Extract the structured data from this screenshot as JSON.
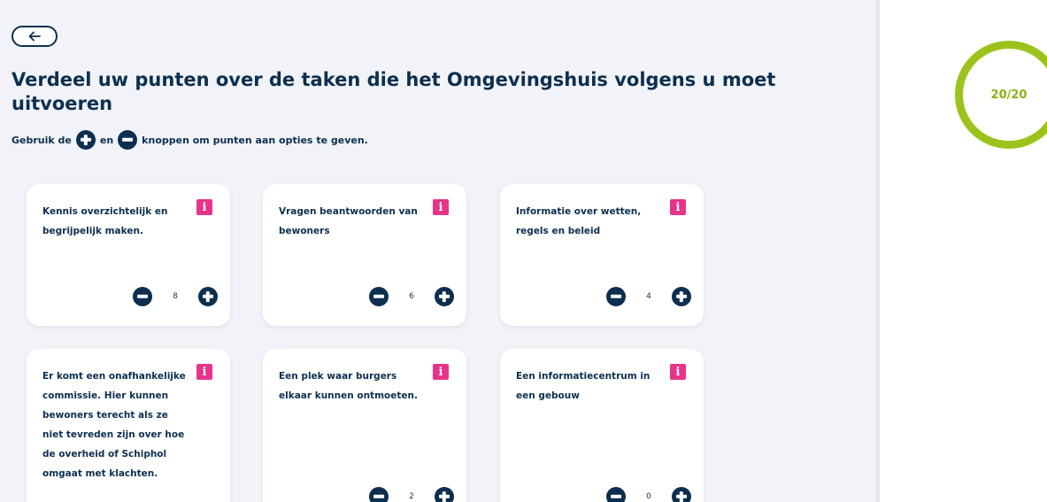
{
  "back_button": {
    "icon": "arrow-left-icon",
    "glyph": "←"
  },
  "title": "Verdeel uw punten over de taken die het Omgevingshuis volgens u moet uitvoeren",
  "instructions": {
    "prefix": "Gebruik de",
    "middle": "en",
    "suffix": "knoppen om punten aan opties te geven."
  },
  "options": [
    {
      "label": "Kennis overzichtelijk en begrijpelijk maken.",
      "value": "8",
      "info": "i"
    },
    {
      "label": "Vragen beantwoorden van bewoners",
      "value": "6",
      "info": "i"
    },
    {
      "label": "Informatie over wetten, regels en beleid",
      "value": "4",
      "info": "i"
    },
    {
      "label": "Er komt een onafhankelijke commissie. Hier kunnen bewoners terecht als ze niet tevreden zijn over hoe de overheid of Schiphol omgaat met klachten.",
      "value": "",
      "info": "i"
    },
    {
      "label": "Een plek waar burgers elkaar kunnen ontmoeten.",
      "value": "2",
      "info": "i"
    },
    {
      "label": "Een informatiecentrum in een gebouw",
      "value": "0",
      "info": "i"
    }
  ],
  "score": {
    "text": "20/20"
  },
  "colors": {
    "primary": "#0d2f4f",
    "info": "#e8338a",
    "accent": "#9cc31b",
    "background": "#f1f3f8"
  }
}
